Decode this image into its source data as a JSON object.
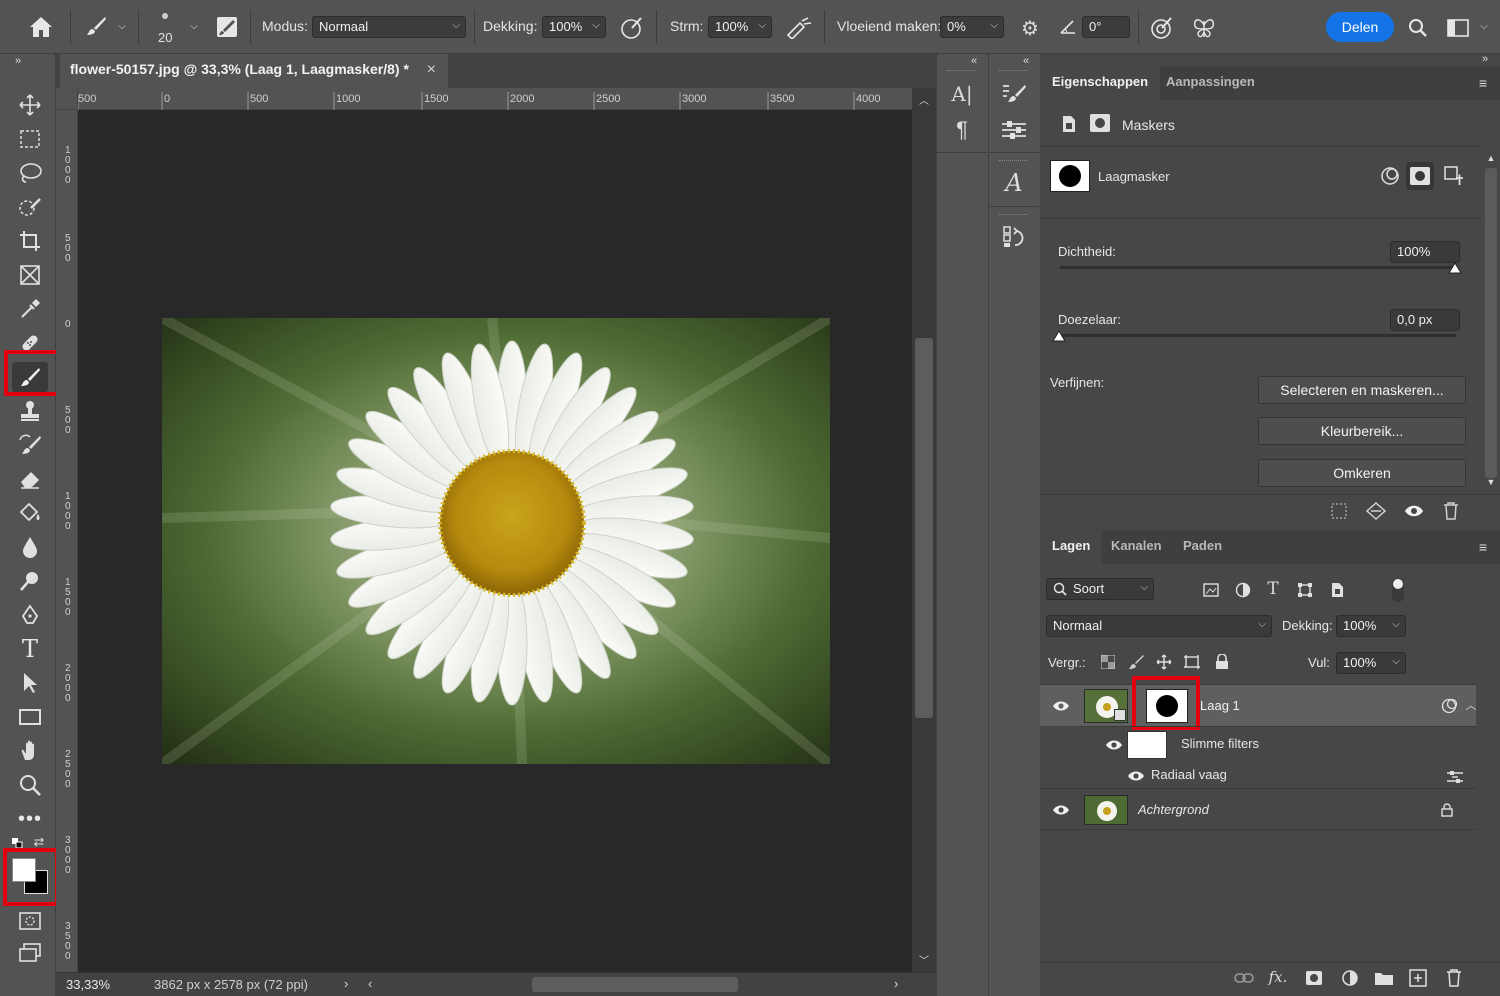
{
  "options_bar": {
    "brush_size": "20",
    "mode_label": "Modus:",
    "mode_value": "Normaal",
    "opacity_label": "Dekking:",
    "opacity_value": "100%",
    "flow_label": "Strm:",
    "flow_value": "100%",
    "smoothing_label": "Vloeiend maken:",
    "smoothing_value": "0%",
    "angle_value": "0°",
    "share_label": "Delen"
  },
  "document": {
    "tab_title": "flower-50157.jpg @ 33,3% (Laag 1, Laagmasker/8) *",
    "close_glyph": "×",
    "ruler_h": [
      "500",
      "0",
      "500",
      "1000",
      "1500",
      "2000",
      "2500",
      "3000",
      "3500",
      "4000"
    ],
    "ruler_v": [
      "1\n0\n0\n0",
      "5\n0\n0",
      "0",
      "5\n0\n0",
      "1\n0\n0\n0",
      "1\n5\n0\n0",
      "2\n0\n0\n0",
      "2\n5\n0\n0",
      "3\n0\n0\n0",
      "3\n5\n0\n0"
    ],
    "zoom": "33,33%",
    "dimensions": "3862 px x 2578 px (72 ppi)"
  },
  "properties_panel": {
    "tabs": [
      "Eigenschappen",
      "Aanpassingen"
    ],
    "section_title": "Maskers",
    "mask_label": "Laagmasker",
    "density_label": "Dichtheid:",
    "density_value": "100%",
    "feather_label": "Doezelaar:",
    "feather_value": "0,0 px",
    "refine_label": "Verfijnen:",
    "buttons": [
      "Selecteren en maskeren...",
      "Kleurbereik...",
      "Omkeren"
    ]
  },
  "layers_panel": {
    "tabs": [
      "Lagen",
      "Kanalen",
      "Paden"
    ],
    "filter_kind": "Soort",
    "blend_mode": "Normaal",
    "opacity_label": "Dekking:",
    "opacity_value": "100%",
    "lock_label": "Vergr.:",
    "fill_label": "Vul:",
    "fill_value": "100%",
    "layers": [
      {
        "name": "Laag 1"
      },
      {
        "name": "Slimme filters"
      },
      {
        "name": "Radiaal vaag"
      },
      {
        "name": "Achtergrond"
      }
    ],
    "footer_fx": "fx."
  },
  "colors": {
    "accent_blue": "#1473e6",
    "highlight_red": "#e3000f",
    "panel_bg": "#474747",
    "ui_bg": "#535353",
    "canvas_bg": "#282828"
  }
}
